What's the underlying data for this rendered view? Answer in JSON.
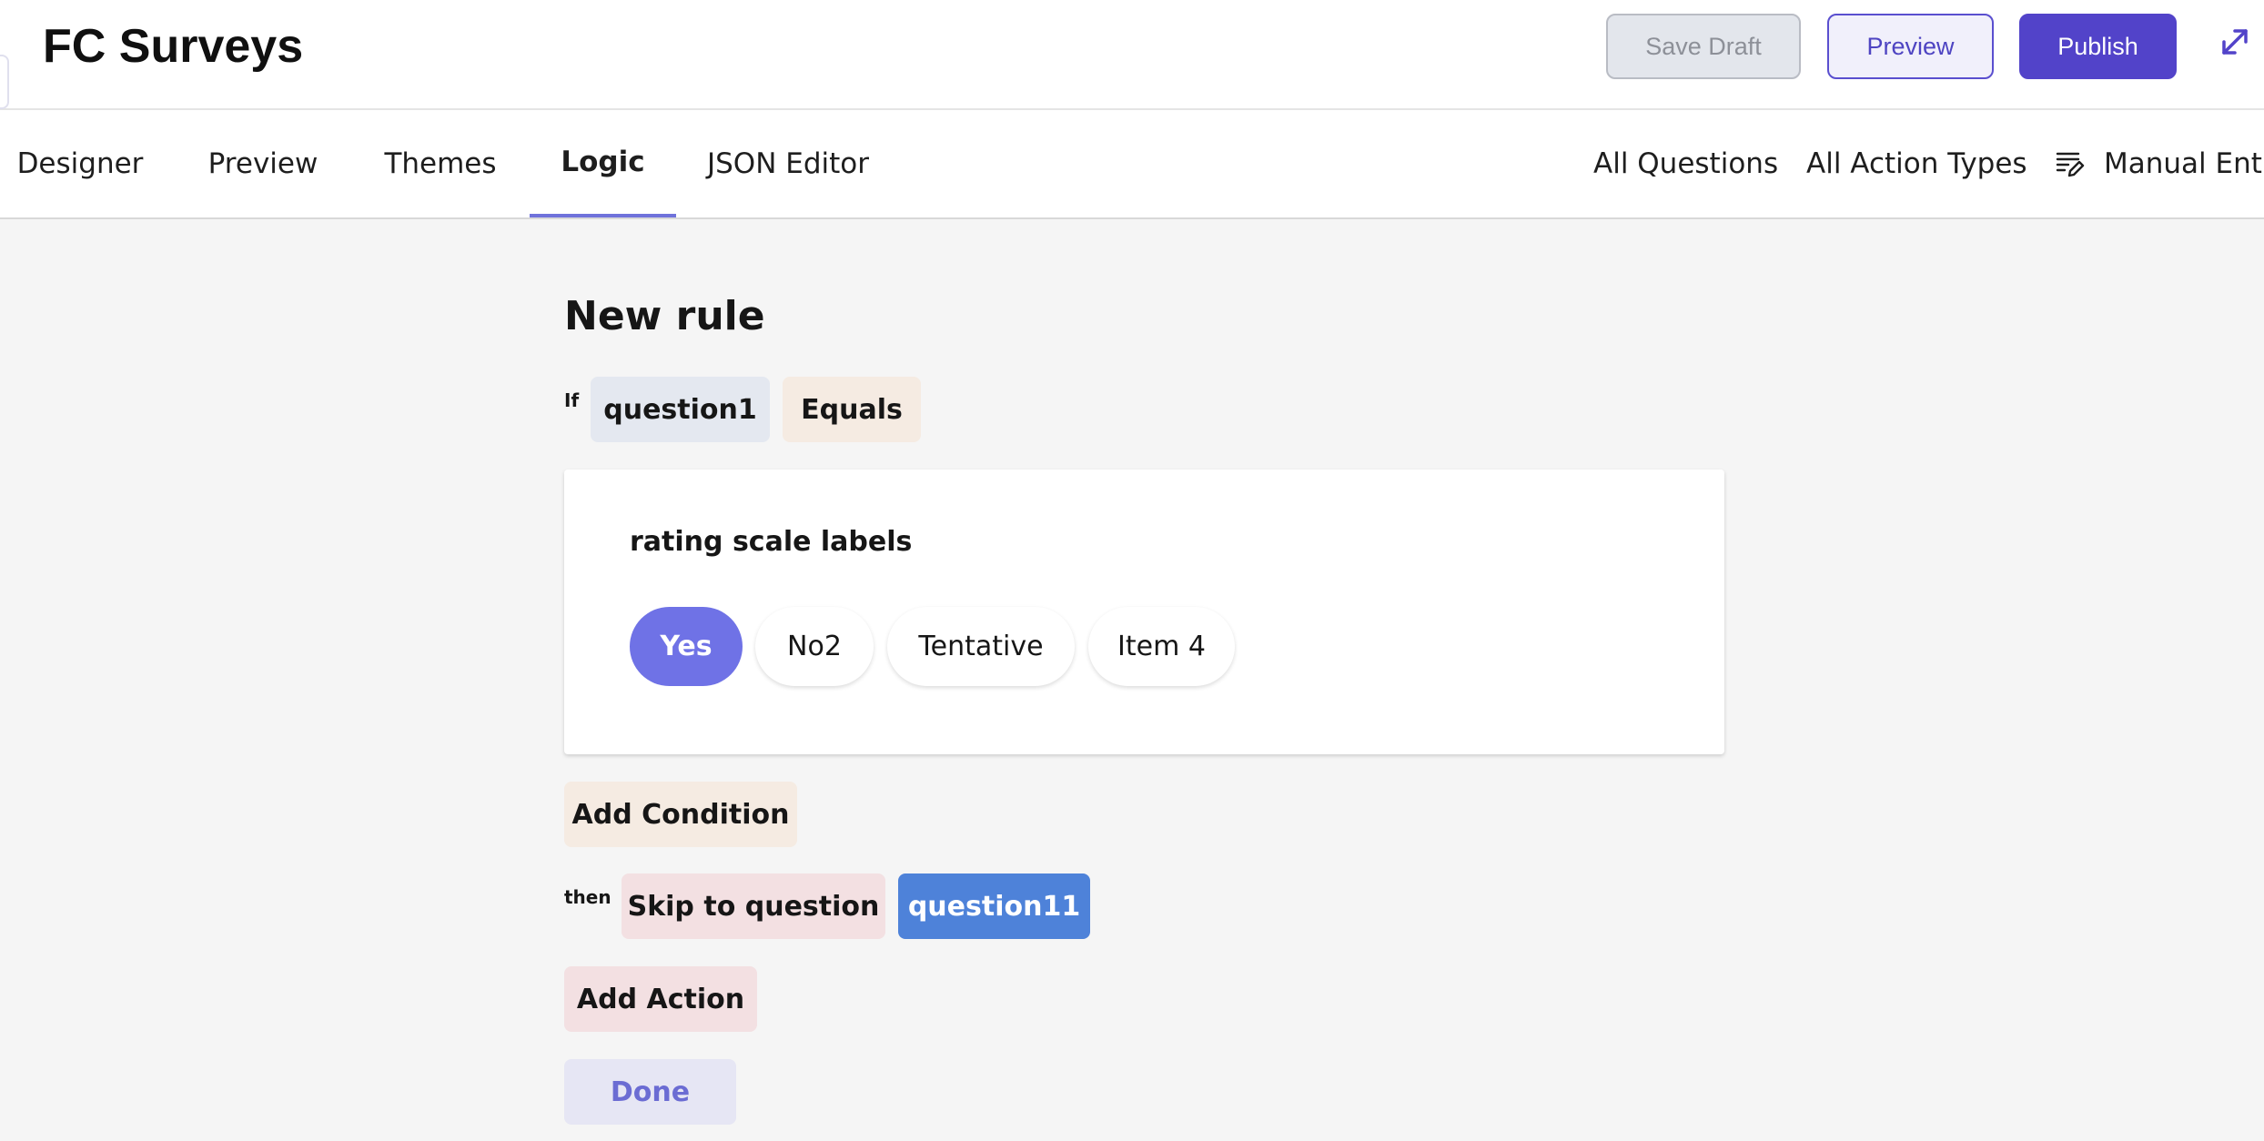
{
  "header": {
    "title": "FC Surveys",
    "save_draft_label": "Save Draft",
    "preview_label": "Preview",
    "publish_label": "Publish"
  },
  "tabs": [
    {
      "label": "Designer"
    },
    {
      "label": "Preview"
    },
    {
      "label": "Themes"
    },
    {
      "label": "Logic",
      "active": true
    },
    {
      "label": "JSON Editor"
    }
  ],
  "filters": {
    "questions_label": "All Questions",
    "action_types_label": "All Action Types",
    "manual_entry_label": "Manual Entry"
  },
  "rule": {
    "title": "New rule",
    "if_label": "If",
    "question_chip": "question1",
    "operator_chip": "Equals",
    "condition_question_title": "rating scale labels",
    "options": [
      {
        "label": "Yes",
        "selected": true
      },
      {
        "label": "No2",
        "selected": false
      },
      {
        "label": "Tentative",
        "selected": false
      },
      {
        "label": "Item 4",
        "selected": false
      }
    ],
    "add_condition_label": "Add Condition",
    "then_label": "then",
    "action_chip": "Skip to question",
    "target_chip": "question11",
    "add_action_label": "Add Action",
    "done_label": "Done"
  },
  "colors": {
    "accent": "#5243c9",
    "selected_option": "#6f72e6",
    "target_chip": "#4e82d9",
    "tab_underline": "#6f72db"
  },
  "icons": {
    "expand": "expand-icon",
    "manual_entry": "edit-list-icon"
  }
}
